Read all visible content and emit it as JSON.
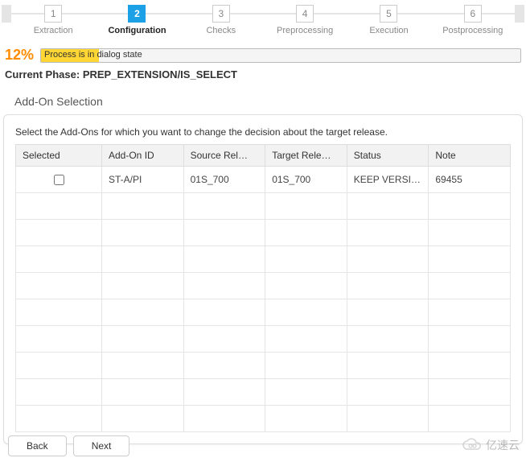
{
  "stepper": {
    "steps": [
      {
        "num": "1",
        "label": "Extraction"
      },
      {
        "num": "2",
        "label": "Configuration"
      },
      {
        "num": "3",
        "label": "Checks"
      },
      {
        "num": "4",
        "label": "Preprocessing"
      },
      {
        "num": "5",
        "label": "Execution"
      },
      {
        "num": "6",
        "label": "Postprocessing"
      }
    ],
    "active_index": 1
  },
  "progress": {
    "percent_label": "12%",
    "percent_value": 12,
    "status_text": "Process is in dialog state"
  },
  "phase": {
    "prefix": "Current Phase: ",
    "value": "PREP_EXTENSION/IS_SELECT"
  },
  "section_title": "Add-On Selection",
  "frame": {
    "message": "Select the Add-Ons for which you want to change the decision about the target release."
  },
  "table": {
    "headers": {
      "selected": "Selected",
      "addon_id": "Add-On ID",
      "source": "Source Rel…",
      "target": "Target Rele…",
      "status": "Status",
      "note": "Note"
    },
    "rows": [
      {
        "selected": false,
        "addon_id": "ST-A/PI",
        "source": "01S_700",
        "target": "01S_700",
        "status": "KEEP VERSI…",
        "note": "69455"
      }
    ],
    "empty_rows": 9
  },
  "buttons": {
    "back": "Back",
    "next": "Next"
  },
  "watermark": "亿速云"
}
